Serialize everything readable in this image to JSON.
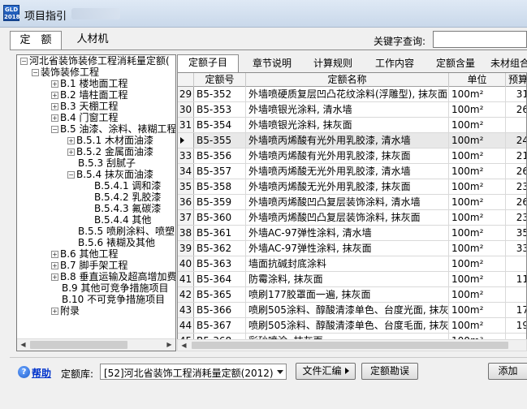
{
  "window": {
    "title": "项目指引"
  },
  "top_tabs": {
    "quota": "定　额",
    "labor": "人材机"
  },
  "keyword": {
    "label": "关键字查询:",
    "value": ""
  },
  "tree": {
    "items": [
      {
        "label": "河北省装饰装修工程消耗量定额(",
        "toggle": "−"
      },
      {
        "label": "装饰装修工程",
        "toggle": "−"
      },
      {
        "label": "B.1 楼地面工程",
        "toggle": "+"
      },
      {
        "label": "B.2 墙柱面工程",
        "toggle": "+"
      },
      {
        "label": "B.3 天棚工程",
        "toggle": "+"
      },
      {
        "label": "B.4 门窗工程",
        "toggle": "+"
      },
      {
        "label": "B.5 油漆、涂料、裱糊工程",
        "toggle": "−"
      },
      {
        "label": "B.5.1 木材面油漆",
        "toggle": "+"
      },
      {
        "label": "B.5.2 金属面油漆",
        "toggle": "+"
      },
      {
        "label": "B.5.3 刮腻子",
        "toggle": ""
      },
      {
        "label": "B.5.4 抹灰面油漆",
        "toggle": "−"
      },
      {
        "label": "B.5.4.1 调和漆",
        "toggle": ""
      },
      {
        "label": "B.5.4.2 乳胶漆",
        "toggle": ""
      },
      {
        "label": "B.5.4.3 氟碳漆",
        "toggle": ""
      },
      {
        "label": "B.5.4.4 其他",
        "toggle": ""
      },
      {
        "label": "B.5.5 喷刷涂料、喷塑",
        "toggle": ""
      },
      {
        "label": "B.5.6 裱糊及其他",
        "toggle": ""
      },
      {
        "label": "B.6 其他工程",
        "toggle": "+"
      },
      {
        "label": "B.7 脚手架工程",
        "toggle": "+"
      },
      {
        "label": "B.8 垂直运输及超高增加费",
        "toggle": "+"
      },
      {
        "label": "B.9 其他可竞争措施项目",
        "toggle": ""
      },
      {
        "label": "B.10 不可竞争措施项目",
        "toggle": ""
      },
      {
        "label": "附录",
        "toggle": "+"
      }
    ]
  },
  "sub_tabs": [
    "定额子目",
    "章节说明",
    "计算规则",
    "工作内容",
    "定额含量",
    "未材组合"
  ],
  "grid": {
    "headers": {
      "num": "",
      "code": "定额号",
      "name": "定额名称",
      "unit": "单位",
      "price": "预算"
    },
    "rows": [
      {
        "num": "29",
        "code": "B5-352",
        "name": "外墙喷硬质复层凹凸花纹涂料(浮雕型), 抹灰面",
        "unit": "100m²",
        "price": "31"
      },
      {
        "num": "30",
        "code": "B5-353",
        "name": "外墙喷银光涂料, 清水墙",
        "unit": "100m²",
        "price": "26"
      },
      {
        "num": "31",
        "code": "B5-354",
        "name": "外墙喷银光涂料, 抹灰面",
        "unit": "100m²",
        "price": ""
      },
      {
        "num": "32",
        "code": "B5-355",
        "name": "外墙喷丙烯酸有光外用乳胶漆, 清水墙",
        "unit": "100m²",
        "price": "24"
      },
      {
        "num": "33",
        "code": "B5-356",
        "name": "外墙喷丙烯酸有光外用乳胶漆, 抹灰面",
        "unit": "100m²",
        "price": "21"
      },
      {
        "num": "34",
        "code": "B5-357",
        "name": "外墙喷丙烯酸无光外用乳胶漆, 清水墙",
        "unit": "100m²",
        "price": "26"
      },
      {
        "num": "35",
        "code": "B5-358",
        "name": "外墙喷丙烯酸无光外用乳胶漆, 抹灰面",
        "unit": "100m²",
        "price": "23"
      },
      {
        "num": "36",
        "code": "B5-359",
        "name": "外墙喷丙烯酸凹凸复层装饰涂料, 清水墙",
        "unit": "100m²",
        "price": "26"
      },
      {
        "num": "37",
        "code": "B5-360",
        "name": "外墙喷丙烯酸凹凸复层装饰涂料, 抹灰面",
        "unit": "100m²",
        "price": "23"
      },
      {
        "num": "38",
        "code": "B5-361",
        "name": "外墙AC-97弹性涂料, 清水墙",
        "unit": "100m²",
        "price": "35"
      },
      {
        "num": "39",
        "code": "B5-362",
        "name": "外墙AC-97弹性涂料, 抹灰面",
        "unit": "100m²",
        "price": "33"
      },
      {
        "num": "40",
        "code": "B5-363",
        "name": "墙面抗碱封底涂料",
        "unit": "100m²",
        "price": ""
      },
      {
        "num": "41",
        "code": "B5-364",
        "name": "防霉涂料, 抹灰面",
        "unit": "100m²",
        "price": "11"
      },
      {
        "num": "42",
        "code": "B5-365",
        "name": "喷刷177胶罩面一遍, 抹灰面",
        "unit": "100m²",
        "price": ""
      },
      {
        "num": "43",
        "code": "B5-366",
        "name": "喷刷505涂料、醇酸清漆单色、台度光面, 抹灰面",
        "unit": "100m²",
        "price": "17"
      },
      {
        "num": "44",
        "code": "B5-367",
        "name": "喷刷505涂料、醇酸清漆单色、台度毛面, 抹灰面",
        "unit": "100m²",
        "price": "19"
      },
      {
        "num": "45",
        "code": "B5-368",
        "name": "彩砂喷涂, 抹灰面",
        "unit": "100m²",
        "price": ""
      }
    ],
    "selected_row": 3
  },
  "bottom": {
    "help": "帮助",
    "library_label": "定额库:",
    "library_value": "[52]河北省装饰工程消耗量定额(2012)",
    "file_button": "文件汇编",
    "survey_button": "定额勘误",
    "add_button": "添加"
  }
}
